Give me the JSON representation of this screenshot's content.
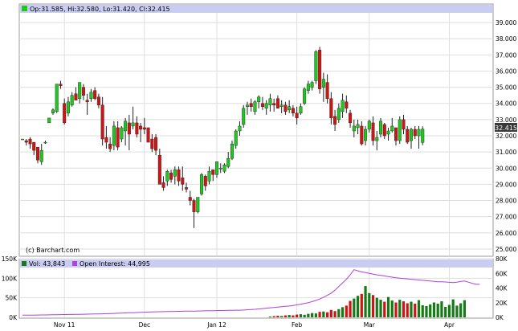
{
  "colors": {
    "up": "#1ec81e",
    "down": "#d01414",
    "volume": "#167a16",
    "open_interest": "#b040e0",
    "legend_bar": "#c9cdf2",
    "last_badge": "#3a3a3a"
  },
  "legend_top": {
    "text": "Op:31.585, Hi:32.580, Lo:31.420, Cl:32.415"
  },
  "legend_bottom": {
    "vol_text": "Vol: 43,843",
    "oi_text": "Open Interest: 44,995"
  },
  "copyright": "(c) Barchart.com",
  "last_price_label": "32.415",
  "chart_data": [
    {
      "type": "candlestick",
      "name": "price",
      "ylim": [
        24.6,
        39.6
      ],
      "y_ticks": [
        "39.000",
        "38.000",
        "37.000",
        "36.000",
        "35.000",
        "34.000",
        "33.000",
        "32.000",
        "31.000",
        "30.000",
        "29.000",
        "28.000",
        "27.000",
        "26.000",
        "25.000"
      ],
      "x_labels": [
        {
          "label": "Nov 11",
          "index": 11
        },
        {
          "label": "Dec",
          "index": 32
        },
        {
          "label": "Jan 12",
          "index": 51
        },
        {
          "label": "Feb",
          "index": 72
        },
        {
          "label": "Mar",
          "index": 91
        },
        {
          "label": "Apr",
          "index": 112
        }
      ],
      "ohlc": [
        [
          31.8,
          31.8,
          31.8,
          31.8
        ],
        [
          31.7,
          31.8,
          31.4,
          31.6
        ],
        [
          31.8,
          31.9,
          31.2,
          31.5
        ],
        [
          31.6,
          31.6,
          30.8,
          31.1
        ],
        [
          31.3,
          31.3,
          30.3,
          30.5
        ],
        [
          30.4,
          31.5,
          30.2,
          31.1
        ],
        [
          31.6,
          31.7,
          31.5,
          31.6
        ],
        [
          32.8,
          33.0,
          32.8,
          33.1
        ],
        [
          33.4,
          33.7,
          33.3,
          33.6
        ],
        [
          33.5,
          35.2,
          33.4,
          35.2
        ],
        [
          35.2,
          35.4,
          34.9,
          35.1
        ],
        [
          34.0,
          34.3,
          32.7,
          32.8
        ],
        [
          33.4,
          34.4,
          33.2,
          34.1
        ],
        [
          33.9,
          34.7,
          33.8,
          34.5
        ],
        [
          34.6,
          35.0,
          34.4,
          34.2
        ],
        [
          34.3,
          35.3,
          34.0,
          35.3
        ],
        [
          35.0,
          35.2,
          34.2,
          34.5
        ],
        [
          34.2,
          34.6,
          33.3,
          34.1
        ],
        [
          34.3,
          34.9,
          34.1,
          34.7
        ],
        [
          34.8,
          35.0,
          34.2,
          34.3
        ],
        [
          34.4,
          34.6,
          33.7,
          33.9
        ],
        [
          33.9,
          34.4,
          31.4,
          31.8
        ],
        [
          31.9,
          32.6,
          31.2,
          31.6
        ],
        [
          31.5,
          31.9,
          31.0,
          31.2
        ],
        [
          31.4,
          32.9,
          31.1,
          32.6
        ],
        [
          32.5,
          32.9,
          31.1,
          31.3
        ],
        [
          31.8,
          32.6,
          31.6,
          32.5
        ],
        [
          32.3,
          33.1,
          31.4,
          32.9
        ],
        [
          32.8,
          33.3,
          31.1,
          32.1
        ],
        [
          32.6,
          33.8,
          32.4,
          32.8
        ],
        [
          32.8,
          33.2,
          31.9,
          32.1
        ],
        [
          32.6,
          32.8,
          31.6,
          32.4
        ],
        [
          32.5,
          33.1,
          32.1,
          32.4
        ],
        [
          32.5,
          32.5,
          31.6,
          31.6
        ],
        [
          31.8,
          32.1,
          31.0,
          31.2
        ],
        [
          31.9,
          32.1,
          30.8,
          31.1
        ],
        [
          30.8,
          31.2,
          29.0,
          29.0
        ],
        [
          29.1,
          29.5,
          28.6,
          28.8
        ],
        [
          29.2,
          29.9,
          28.9,
          29.8
        ],
        [
          29.7,
          29.9,
          29.1,
          29.3
        ],
        [
          29.5,
          30.1,
          29.0,
          29.9
        ],
        [
          29.9,
          30.1,
          28.9,
          29.2
        ],
        [
          29.4,
          30.1,
          28.6,
          29.0
        ],
        [
          28.8,
          29.1,
          28.5,
          28.7
        ],
        [
          28.2,
          28.6,
          27.7,
          28.0
        ],
        [
          28.0,
          28.1,
          26.3,
          27.3
        ],
        [
          27.3,
          28.2,
          27.2,
          28.2
        ],
        [
          28.4,
          29.7,
          28.3,
          29.6
        ],
        [
          29.5,
          29.6,
          28.6,
          28.9
        ],
        [
          29.2,
          30.1,
          29.0,
          29.8
        ],
        [
          29.9,
          29.9,
          29.2,
          29.6
        ],
        [
          29.6,
          30.4,
          29.4,
          30.4
        ],
        [
          30.0,
          30.3,
          29.7,
          30.0
        ],
        [
          29.8,
          30.3,
          29.7,
          30.2
        ],
        [
          30.1,
          31.0,
          30.0,
          30.6
        ],
        [
          30.6,
          31.7,
          30.5,
          31.5
        ],
        [
          31.4,
          32.4,
          31.2,
          32.3
        ],
        [
          32.3,
          32.9,
          32.0,
          32.6
        ],
        [
          32.7,
          33.9,
          32.5,
          33.7
        ],
        [
          33.8,
          34.1,
          33.3,
          33.9
        ],
        [
          34.0,
          34.3,
          33.5,
          33.8
        ],
        [
          33.5,
          34.2,
          33.3,
          34.1
        ],
        [
          34.1,
          34.5,
          33.7,
          34.4
        ],
        [
          34.0,
          34.4,
          33.6,
          33.8
        ],
        [
          33.7,
          34.2,
          33.3,
          34.0
        ],
        [
          33.9,
          34.6,
          33.5,
          34.3
        ],
        [
          34.0,
          34.3,
          33.5,
          33.9
        ],
        [
          34.3,
          34.5,
          33.7,
          33.7
        ],
        [
          33.8,
          34.2,
          33.4,
          33.9
        ],
        [
          33.9,
          34.1,
          33.3,
          33.5
        ],
        [
          33.6,
          34.2,
          33.4,
          33.8
        ],
        [
          33.7,
          33.9,
          33.2,
          33.4
        ],
        [
          33.4,
          33.8,
          32.7,
          33.1
        ],
        [
          33.4,
          34.0,
          33.3,
          33.8
        ],
        [
          34.0,
          35.0,
          33.9,
          34.9
        ],
        [
          34.8,
          35.4,
          34.6,
          35.2
        ],
        [
          35.0,
          35.4,
          34.8,
          35.3
        ],
        [
          35.4,
          37.3,
          35.2,
          37.2
        ],
        [
          37.3,
          37.5,
          34.6,
          34.9
        ],
        [
          35.0,
          35.9,
          34.1,
          35.5
        ],
        [
          35.3,
          35.8,
          34.0,
          34.3
        ],
        [
          34.3,
          34.7,
          32.7,
          33.1
        ],
        [
          33.2,
          33.6,
          32.3,
          32.7
        ],
        [
          33.0,
          34.0,
          32.8,
          33.7
        ],
        [
          33.5,
          34.6,
          33.1,
          34.2
        ],
        [
          34.1,
          34.5,
          33.4,
          33.7
        ],
        [
          33.4,
          33.6,
          32.5,
          32.8
        ],
        [
          32.3,
          33.0,
          31.9,
          32.6
        ],
        [
          32.5,
          33.0,
          32.1,
          32.7
        ],
        [
          32.6,
          32.9,
          31.4,
          31.5
        ],
        [
          31.7,
          32.6,
          31.4,
          32.4
        ],
        [
          32.4,
          33.0,
          32.2,
          32.9
        ],
        [
          32.8,
          33.2,
          31.4,
          31.7
        ],
        [
          31.7,
          32.3,
          31.1,
          31.9
        ],
        [
          32.1,
          33.1,
          31.9,
          32.9
        ],
        [
          32.7,
          32.8,
          31.8,
          32.0
        ],
        [
          32.1,
          32.5,
          31.7,
          32.3
        ],
        [
          32.3,
          33.1,
          32.2,
          32.6
        ],
        [
          32.5,
          32.5,
          31.4,
          31.7
        ],
        [
          31.7,
          33.2,
          31.5,
          33.0
        ],
        [
          33.0,
          33.3,
          32.1,
          32.4
        ],
        [
          32.4,
          32.6,
          31.5,
          31.6
        ],
        [
          31.7,
          32.5,
          31.2,
          32.4
        ],
        [
          32.4,
          32.6,
          31.8,
          32.0
        ],
        [
          32.0,
          32.6,
          31.2,
          32.4
        ],
        [
          31.585,
          32.58,
          31.42,
          32.415
        ]
      ]
    },
    {
      "type": "bar+line",
      "name": "volume_open_interest",
      "left_ticks": [
        "150K",
        "100K",
        "50K",
        "0K"
      ],
      "left_ylim": [
        0,
        150000
      ],
      "right_ticks": [
        "80K",
        "60K",
        "40K",
        "20K",
        "0K"
      ],
      "right_ylim": [
        0,
        80000
      ],
      "volume_start_index": 65,
      "volume": [
        2000,
        3000,
        4000,
        3500,
        5000,
        6000,
        5000,
        7000,
        8000,
        6500,
        9000,
        11000,
        10000,
        14000,
        15000,
        13000,
        19000,
        16000,
        21000,
        26000,
        30000,
        42000,
        48000,
        55000,
        60000,
        80000,
        62000,
        57000,
        50000,
        45000,
        40000,
        52000,
        43000,
        38000,
        45000,
        41000,
        36000,
        40000,
        35000,
        44000,
        31000,
        29000,
        33000,
        38000,
        35000,
        41000,
        27000,
        32000,
        46000,
        30000,
        36000,
        43843
      ],
      "open_interest": [
        3000,
        3000,
        3100,
        3100,
        3200,
        3300,
        3300,
        3400,
        3500,
        3600,
        3700,
        3800,
        3900,
        4000,
        4100,
        4200,
        4300,
        4400,
        4500,
        4600,
        4700,
        4800,
        5000,
        5200,
        5400,
        5600,
        5800,
        6000,
        6200,
        6400,
        6600,
        6800,
        7000,
        7200,
        7400,
        7600,
        7700,
        7800,
        7900,
        8000,
        8100,
        8200,
        8300,
        8400,
        8500,
        8600,
        8700,
        8800,
        8900,
        9000,
        9100,
        9200,
        9300,
        9400,
        9500,
        9600,
        9700,
        9800,
        10000,
        10300,
        10600,
        11000,
        11500,
        12000,
        12500,
        13000,
        13500,
        14000,
        14500,
        15000,
        15500,
        16200,
        17000,
        18000,
        19000,
        20000,
        21500,
        23000,
        25000,
        27500,
        30000,
        33000,
        37000,
        42000,
        47000,
        52000,
        58000,
        65000,
        63500,
        62000,
        61000,
        60000,
        59000,
        58000,
        57200,
        56400,
        55600,
        54800,
        54000,
        53500,
        53000,
        52500,
        52000,
        51500,
        51000,
        50500,
        50000,
        49500,
        49000,
        48500,
        48500,
        48200,
        47800,
        47500,
        48000,
        49000,
        49500,
        48000,
        46500,
        45000,
        44995
      ]
    }
  ]
}
